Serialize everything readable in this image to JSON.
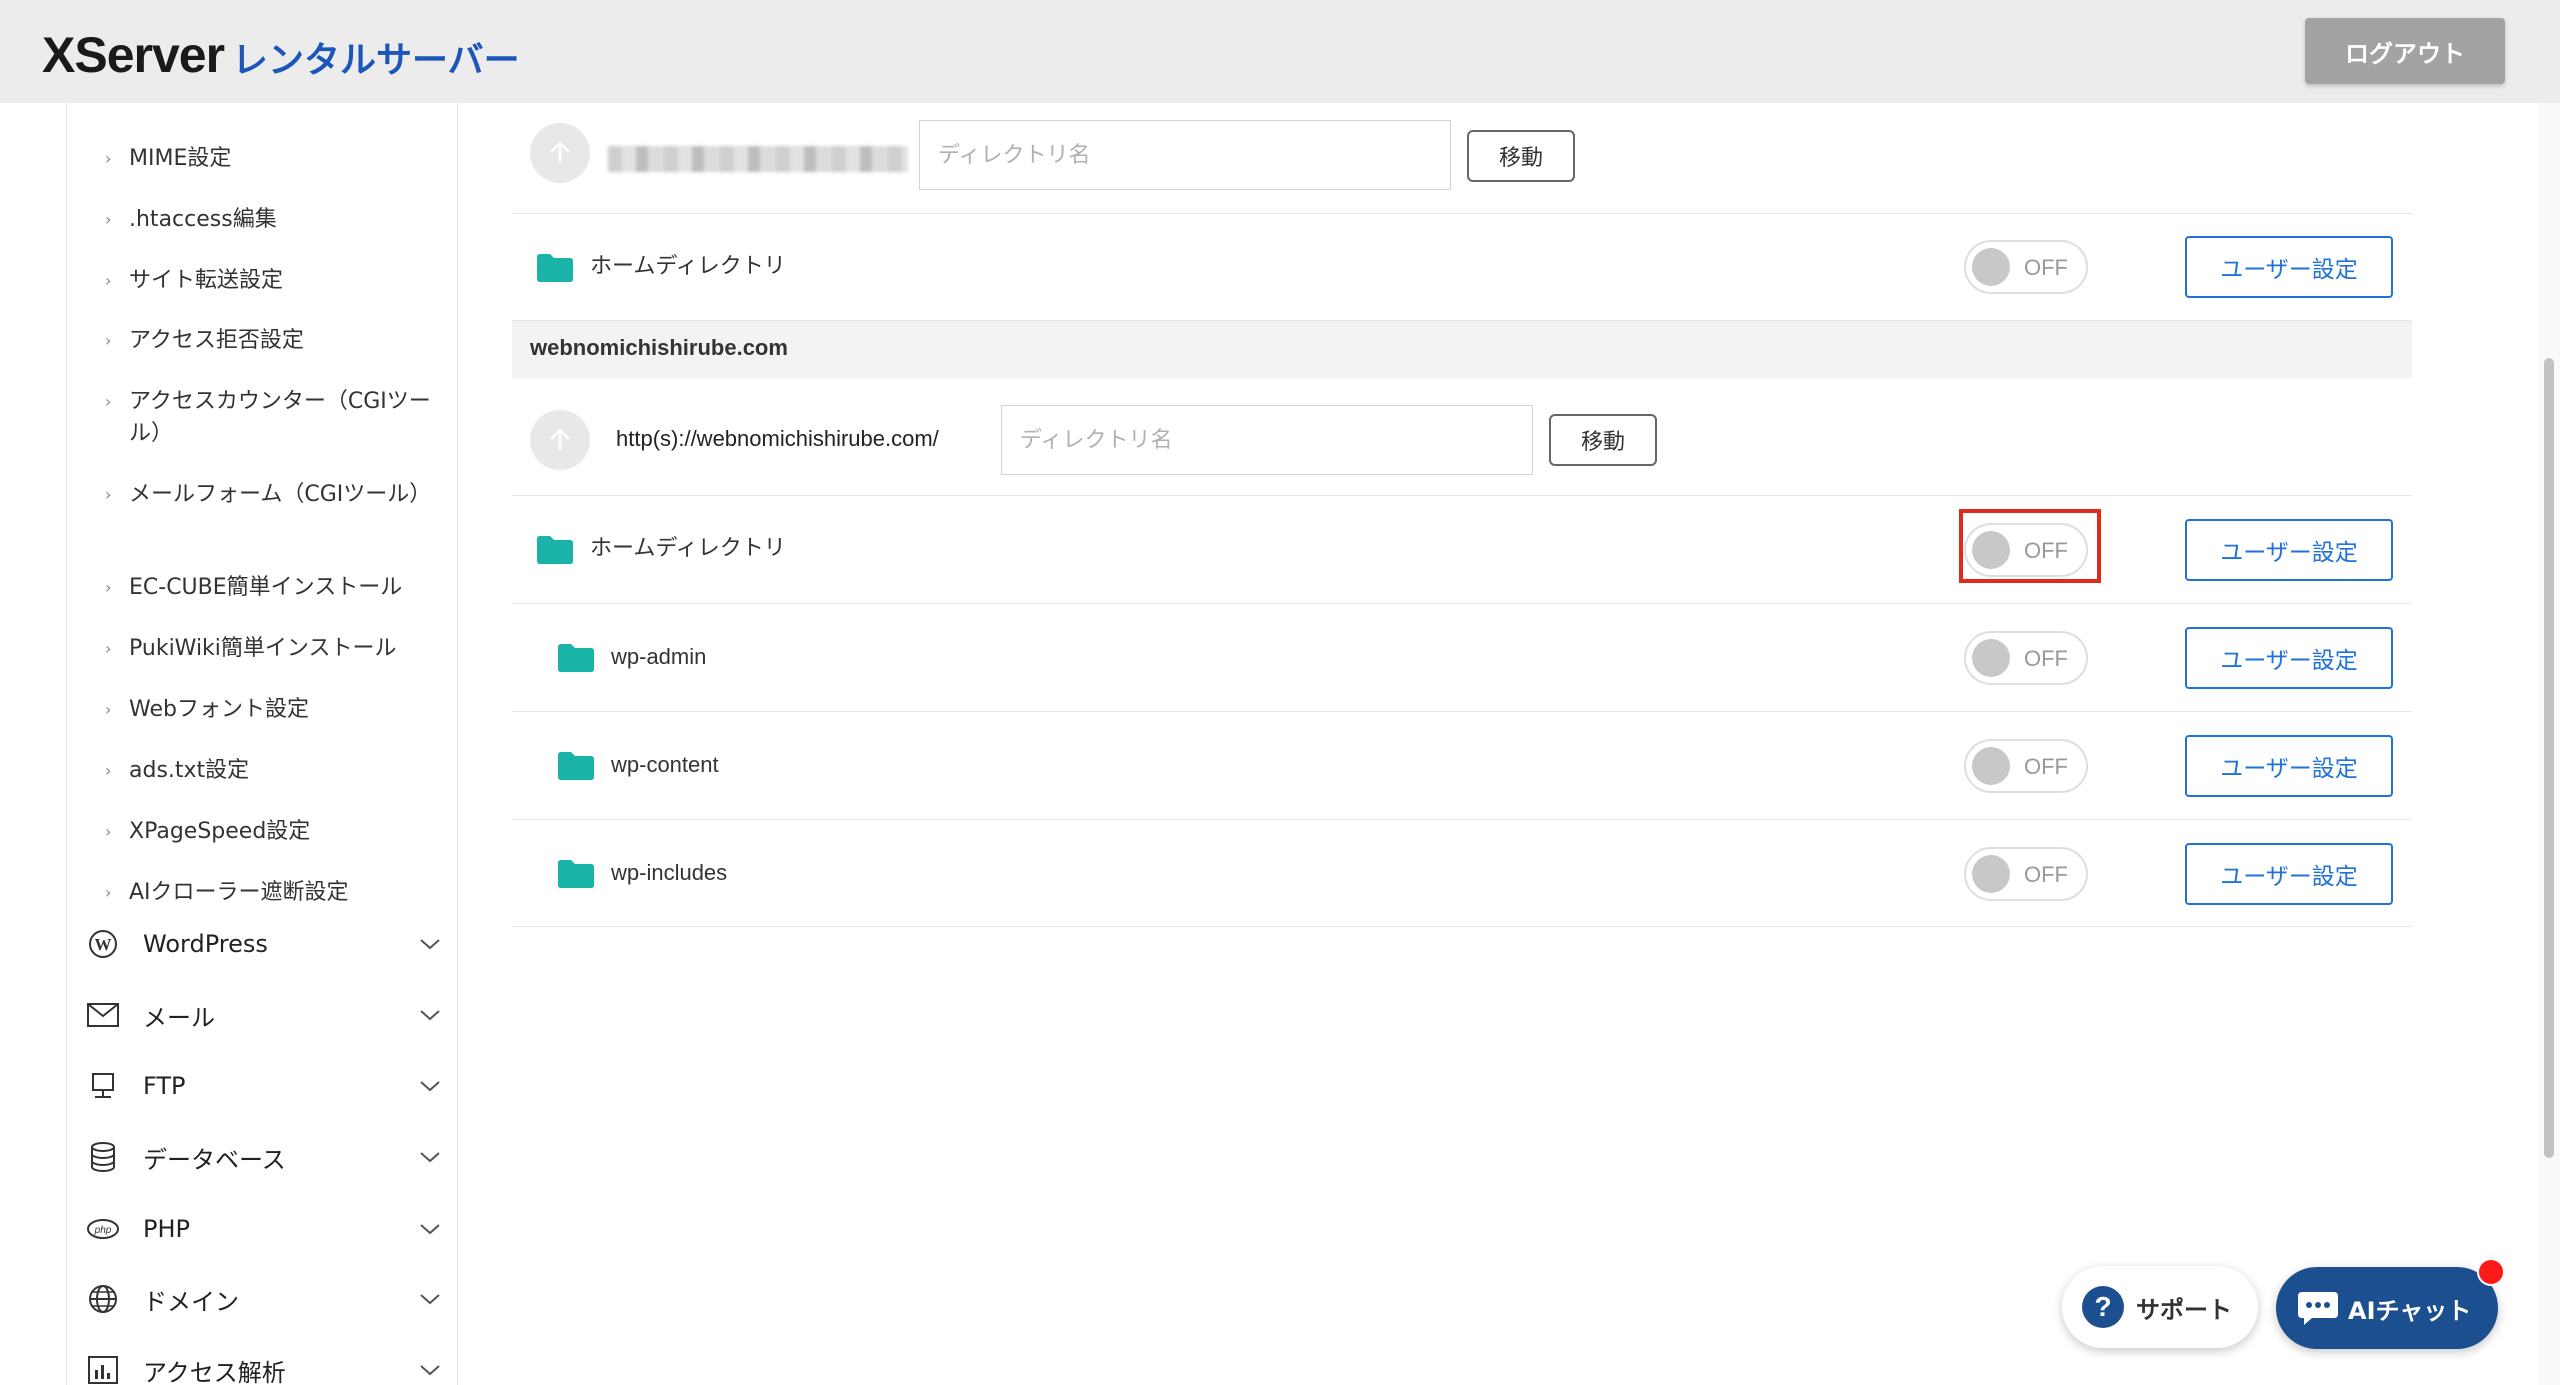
{
  "header": {
    "logo_main": "XServer",
    "logo_sub": "レンタルサーバー",
    "logout_label": "ログアウト"
  },
  "sidebar": {
    "sub_items": [
      {
        "label": "MIME設定"
      },
      {
        "label": ".htaccess編集"
      },
      {
        "label": "サイト転送設定"
      },
      {
        "label": "アクセス拒否設定"
      },
      {
        "label": "アクセスカウンター（CGIツール）"
      },
      {
        "label": "メールフォーム（CGIツール）"
      },
      {
        "label": "EC-CUBE簡単インストール"
      },
      {
        "label": "PukiWiki簡単インストール"
      },
      {
        "label": "Webフォント設定"
      },
      {
        "label": "ads.txt設定"
      },
      {
        "label": "XPageSpeed設定"
      },
      {
        "label": "AIクローラー遮断設定"
      }
    ],
    "categories": [
      {
        "label": "WordPress",
        "icon": "wordpress-icon"
      },
      {
        "label": "メール",
        "icon": "mail-icon"
      },
      {
        "label": "FTP",
        "icon": "ftp-icon"
      },
      {
        "label": "データベース",
        "icon": "database-icon"
      },
      {
        "label": "PHP",
        "icon": "php-icon"
      },
      {
        "label": "ドメイン",
        "icon": "globe-icon"
      },
      {
        "label": "アクセス解析",
        "icon": "analytics-icon"
      }
    ]
  },
  "main": {
    "section1": {
      "dir_placeholder": "ディレクトリ名",
      "move_label": "移動",
      "home_label": "ホームディレクトリ",
      "toggle_label": "OFF",
      "user_settings_label": "ユーザー設定"
    },
    "domain": {
      "name": "webnomichishirube.com",
      "path": "http(s)://webnomichishirube.com/",
      "dir_placeholder": "ディレクトリ名",
      "move_label": "移動",
      "rows": [
        {
          "label": "ホームディレクトリ",
          "toggle": "OFF",
          "button": "ユーザー設定"
        },
        {
          "label": "wp-admin",
          "toggle": "OFF",
          "button": "ユーザー設定"
        },
        {
          "label": "wp-content",
          "toggle": "OFF",
          "button": "ユーザー設定"
        },
        {
          "label": "wp-includes",
          "toggle": "OFF",
          "button": "ユーザー設定"
        }
      ]
    }
  },
  "floating": {
    "support_label": "サポート",
    "support_icon": "?",
    "ai_chat_label": "AIチャット"
  },
  "colors": {
    "accent_blue": "#1f73d8",
    "folder_teal": "#19b3a8",
    "highlight_red": "#e02a1e",
    "floating_navy": "#1b4f8f"
  }
}
